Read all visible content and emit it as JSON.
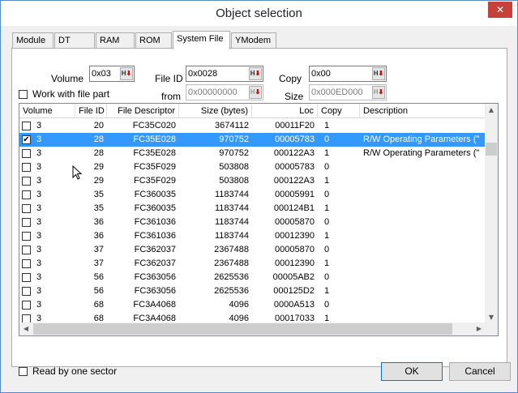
{
  "window": {
    "title": "Object selection",
    "close": "✕"
  },
  "tabs": [
    {
      "label": "Module"
    },
    {
      "label": "DT"
    },
    {
      "label": "RAM"
    },
    {
      "label": "ROM"
    },
    {
      "label": "System File"
    },
    {
      "label": "YModem"
    }
  ],
  "active_tab": "System File",
  "form": {
    "volume_label": "Volume",
    "volume_value": "0x03",
    "fileid_label": "File ID",
    "fileid_value": "0x0028",
    "copy_label": "Copy",
    "copy_value": "0x00",
    "work_with_file_part_label": "Work with file part",
    "from_label": "from",
    "from_value": "0x00000000",
    "size_label": "Size",
    "size_value": "0x000ED000",
    "hex_button": "H"
  },
  "columns": [
    "Volume",
    "File ID",
    "File Descriptor",
    "Size (bytes)",
    "Loc",
    "Copy",
    "Description"
  ],
  "rows": [
    {
      "checked": false,
      "volume": "3",
      "file_id": "20",
      "descriptor": "FC35C020",
      "size": "3674112",
      "loc": "00011F20",
      "copy": "1",
      "description": ""
    },
    {
      "checked": true,
      "volume": "3",
      "file_id": "28",
      "descriptor": "FC35E028",
      "size": "970752",
      "loc": "00005783",
      "copy": "0",
      "description": "R/W Operating Parameters (\""
    },
    {
      "checked": false,
      "volume": "3",
      "file_id": "28",
      "descriptor": "FC35E028",
      "size": "970752",
      "loc": "000122A3",
      "copy": "1",
      "description": "R/W Operating Parameters (\""
    },
    {
      "checked": false,
      "volume": "3",
      "file_id": "29",
      "descriptor": "FC35F029",
      "size": "503808",
      "loc": "00005783",
      "copy": "0",
      "description": ""
    },
    {
      "checked": false,
      "volume": "3",
      "file_id": "29",
      "descriptor": "FC35F029",
      "size": "503808",
      "loc": "000122A3",
      "copy": "1",
      "description": ""
    },
    {
      "checked": false,
      "volume": "3",
      "file_id": "35",
      "descriptor": "FC360035",
      "size": "1183744",
      "loc": "00005991",
      "copy": "0",
      "description": ""
    },
    {
      "checked": false,
      "volume": "3",
      "file_id": "35",
      "descriptor": "FC360035",
      "size": "1183744",
      "loc": "000124B1",
      "copy": "1",
      "description": ""
    },
    {
      "checked": false,
      "volume": "3",
      "file_id": "36",
      "descriptor": "FC361036",
      "size": "1183744",
      "loc": "00005870",
      "copy": "0",
      "description": ""
    },
    {
      "checked": false,
      "volume": "3",
      "file_id": "36",
      "descriptor": "FC361036",
      "size": "1183744",
      "loc": "00012390",
      "copy": "1",
      "description": ""
    },
    {
      "checked": false,
      "volume": "3",
      "file_id": "37",
      "descriptor": "FC362037",
      "size": "2367488",
      "loc": "00005870",
      "copy": "0",
      "description": ""
    },
    {
      "checked": false,
      "volume": "3",
      "file_id": "37",
      "descriptor": "FC362037",
      "size": "2367488",
      "loc": "00012390",
      "copy": "1",
      "description": ""
    },
    {
      "checked": false,
      "volume": "3",
      "file_id": "56",
      "descriptor": "FC363056",
      "size": "2625536",
      "loc": "00005AB2",
      "copy": "0",
      "description": ""
    },
    {
      "checked": false,
      "volume": "3",
      "file_id": "56",
      "descriptor": "FC363056",
      "size": "2625536",
      "loc": "000125D2",
      "copy": "1",
      "description": ""
    },
    {
      "checked": false,
      "volume": "3",
      "file_id": "68",
      "descriptor": "FC3A4068",
      "size": "4096",
      "loc": "0000A513",
      "copy": "0",
      "description": ""
    },
    {
      "checked": false,
      "volume": "3",
      "file_id": "68",
      "descriptor": "FC3A4068",
      "size": "4096",
      "loc": "00017033",
      "copy": "1",
      "description": ""
    }
  ],
  "selected_row": 1,
  "footer": {
    "read_by_one_sector_label": "Read by one sector",
    "ok_label": "OK",
    "cancel_label": "Cancel"
  },
  "colors": {
    "selection": "#3399ff",
    "close_button": "#c7413a",
    "hex_arrow": "#dd0000"
  }
}
